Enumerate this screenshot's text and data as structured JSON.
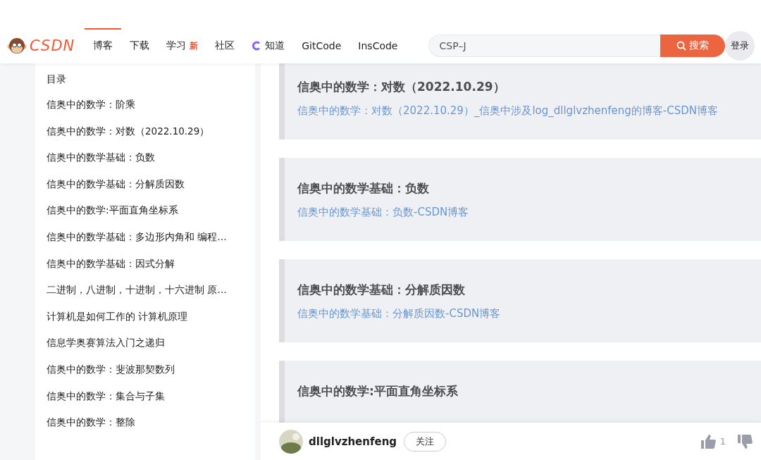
{
  "header": {
    "logo": "CSDN",
    "nav": [
      {
        "label": "博客",
        "selected": true
      },
      {
        "label": "下载",
        "selected": false
      },
      {
        "label": "学习",
        "badge": "新",
        "selected": false
      },
      {
        "label": "社区",
        "selected": false
      },
      {
        "label": "知道",
        "kind": "icon",
        "selected": false
      },
      {
        "label": "GitCode",
        "selected": false
      },
      {
        "label": "InsCode",
        "selected": false
      }
    ],
    "search": {
      "value": "CSP–J",
      "button": "搜索"
    },
    "login": "登录"
  },
  "toc": {
    "title": "目录",
    "items": [
      "信奥中的数学：阶乘",
      "信奥中的数学：对数（2022.10.29）",
      "信奥中的数学基础：负数",
      "信奥中的数学基础：分解质因数",
      "信奥中的数学:平面直角坐标系",
      "信奥中的数学基础：多边形内角和 编程…",
      "信奥中的数学基础：因式分解",
      "二进制，八进制，十进制，十六进制 原…",
      "计算机是如何工作的 计算机原理",
      "信息学奥赛算法入门之递归",
      "信奥中的数学：斐波那契数列",
      "信奥中的数学：集合与子集",
      "信奥中的数学：整除"
    ]
  },
  "cards": [
    {
      "title": "信奥中的数学：对数（2022.10.29）",
      "link": "信奥中的数学：对数（2022.10.29）_信奥中涉及log_dllglvzhenfeng的博客-CSDN博客"
    },
    {
      "title": "信奥中的数学基础：负数",
      "link": "信奥中的数学基础：负数-CSDN博客"
    },
    {
      "title": "信奥中的数学基础：分解质因数",
      "link": "信奥中的数学基础：分解质因数-CSDN博客"
    },
    {
      "title": "信奥中的数学:平面直角坐标系"
    }
  ],
  "footer": {
    "author": "dllglvzhenfeng",
    "follow": "关注",
    "likes": "1"
  }
}
